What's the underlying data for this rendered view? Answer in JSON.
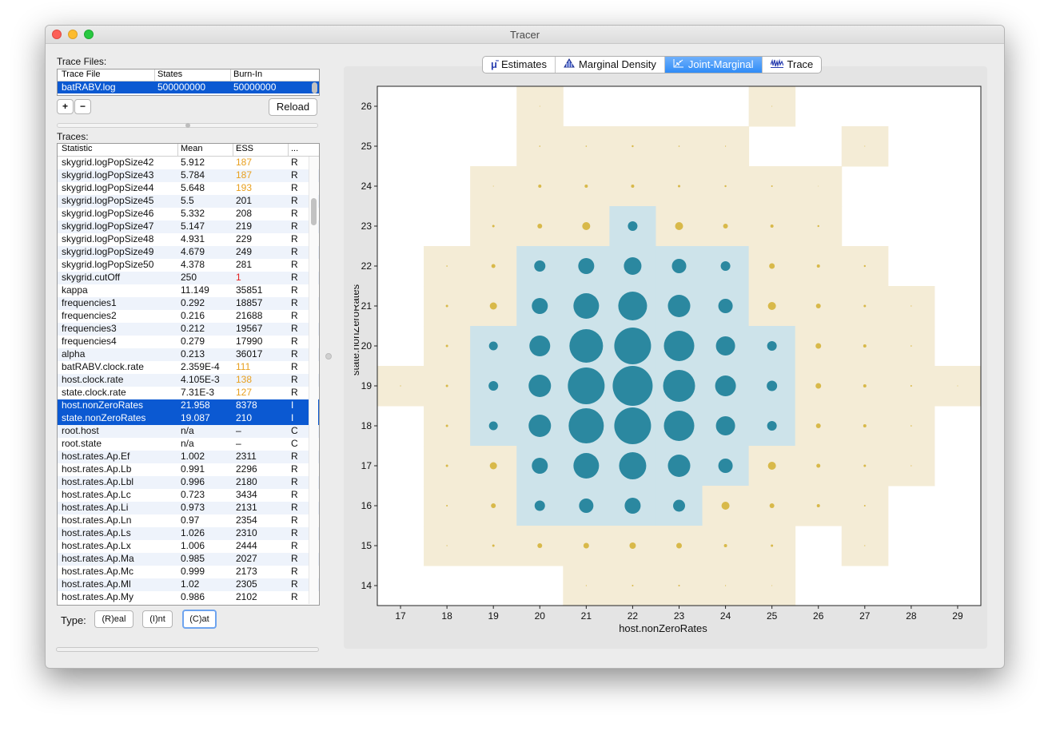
{
  "window": {
    "title": "Tracer"
  },
  "trace_files": {
    "label": "Trace Files:",
    "columns": [
      "Trace File",
      "States",
      "Burn-In"
    ],
    "row": {
      "file": "batRABV.log",
      "states": "500000000",
      "burnin": "50000000"
    },
    "add_label": "+",
    "remove_label": "−",
    "reload_label": "Reload"
  },
  "traces": {
    "label": "Traces:",
    "columns": [
      "Statistic",
      "Mean",
      "ESS",
      "..."
    ],
    "rows": [
      {
        "stat": "skygrid.logPopSize42",
        "mean": "5.912",
        "ess": "187",
        "type": "R",
        "ess_color": "#e8a020"
      },
      {
        "stat": "skygrid.logPopSize43",
        "mean": "5.784",
        "ess": "187",
        "type": "R",
        "ess_color": "#e8a020"
      },
      {
        "stat": "skygrid.logPopSize44",
        "mean": "5.648",
        "ess": "193",
        "type": "R",
        "ess_color": "#e8a020"
      },
      {
        "stat": "skygrid.logPopSize45",
        "mean": "5.5",
        "ess": "201",
        "type": "R"
      },
      {
        "stat": "skygrid.logPopSize46",
        "mean": "5.332",
        "ess": "208",
        "type": "R"
      },
      {
        "stat": "skygrid.logPopSize47",
        "mean": "5.147",
        "ess": "219",
        "type": "R"
      },
      {
        "stat": "skygrid.logPopSize48",
        "mean": "4.931",
        "ess": "229",
        "type": "R"
      },
      {
        "stat": "skygrid.logPopSize49",
        "mean": "4.679",
        "ess": "249",
        "type": "R"
      },
      {
        "stat": "skygrid.logPopSize50",
        "mean": "4.378",
        "ess": "281",
        "type": "R"
      },
      {
        "stat": "skygrid.cutOff",
        "mean": "250",
        "ess": "1",
        "type": "R",
        "ess_color": "#e32020"
      },
      {
        "stat": "kappa",
        "mean": "11.149",
        "ess": "35851",
        "type": "R"
      },
      {
        "stat": "frequencies1",
        "mean": "0.292",
        "ess": "18857",
        "type": "R"
      },
      {
        "stat": "frequencies2",
        "mean": "0.216",
        "ess": "21688",
        "type": "R"
      },
      {
        "stat": "frequencies3",
        "mean": "0.212",
        "ess": "19567",
        "type": "R"
      },
      {
        "stat": "frequencies4",
        "mean": "0.279",
        "ess": "17990",
        "type": "R"
      },
      {
        "stat": "alpha",
        "mean": "0.213",
        "ess": "36017",
        "type": "R"
      },
      {
        "stat": "batRABV.clock.rate",
        "mean": "2.359E-4",
        "ess": "111",
        "type": "R",
        "ess_color": "#e8a020"
      },
      {
        "stat": "host.clock.rate",
        "mean": "4.105E-3",
        "ess": "138",
        "type": "R",
        "ess_color": "#e8a020"
      },
      {
        "stat": "state.clock.rate",
        "mean": "7.31E-3",
        "ess": "127",
        "type": "R",
        "ess_color": "#e8a020"
      },
      {
        "stat": "host.nonZeroRates",
        "mean": "21.958",
        "ess": "8378",
        "type": "I",
        "selected": true
      },
      {
        "stat": "state.nonZeroRates",
        "mean": "19.087",
        "ess": "210",
        "type": "I",
        "selected": true
      },
      {
        "stat": "root.host",
        "mean": "n/a",
        "ess": "–",
        "type": "C"
      },
      {
        "stat": "root.state",
        "mean": "n/a",
        "ess": "–",
        "type": "C"
      },
      {
        "stat": "host.rates.Ap.Ef",
        "mean": "1.002",
        "ess": "2311",
        "type": "R"
      },
      {
        "stat": "host.rates.Ap.Lb",
        "mean": "0.991",
        "ess": "2296",
        "type": "R"
      },
      {
        "stat": "host.rates.Ap.Lbl",
        "mean": "0.996",
        "ess": "2180",
        "type": "R"
      },
      {
        "stat": "host.rates.Ap.Lc",
        "mean": "0.723",
        "ess": "3434",
        "type": "R"
      },
      {
        "stat": "host.rates.Ap.Li",
        "mean": "0.973",
        "ess": "2131",
        "type": "R"
      },
      {
        "stat": "host.rates.Ap.Ln",
        "mean": "0.97",
        "ess": "2354",
        "type": "R"
      },
      {
        "stat": "host.rates.Ap.Ls",
        "mean": "1.026",
        "ess": "2310",
        "type": "R"
      },
      {
        "stat": "host.rates.Ap.Lx",
        "mean": "1.006",
        "ess": "2444",
        "type": "R"
      },
      {
        "stat": "host.rates.Ap.Ma",
        "mean": "0.985",
        "ess": "2027",
        "type": "R"
      },
      {
        "stat": "host.rates.Ap.Mc",
        "mean": "0.999",
        "ess": "2173",
        "type": "R"
      },
      {
        "stat": "host.rates.Ap.Ml",
        "mean": "1.02",
        "ess": "2305",
        "type": "R"
      },
      {
        "stat": "host.rates.Ap.My",
        "mean": "0.986",
        "ess": "2102",
        "type": "R"
      }
    ]
  },
  "type_selector": {
    "label": "Type:",
    "options": [
      "(R)eal",
      "(I)nt",
      "(C)at"
    ],
    "selected": "(C)at"
  },
  "tabs": [
    {
      "label": "Estimates",
      "icon": "mu-icon"
    },
    {
      "label": "Marginal Density",
      "icon": "density-icon"
    },
    {
      "label": "Joint-Marginal",
      "icon": "joint-icon",
      "active": true
    },
    {
      "label": "Trace",
      "icon": "trace-icon"
    }
  ],
  "chart_data": {
    "type": "scatter",
    "xlabel": "host.nonZeroRates",
    "ylabel": "state.nonZeroRates",
    "xlim": [
      16.5,
      29.5
    ],
    "ylim": [
      13.5,
      26.5
    ],
    "xticks": [
      17,
      18,
      19,
      20,
      21,
      22,
      23,
      24,
      25,
      26,
      27,
      28,
      29
    ],
    "yticks": [
      14,
      15,
      16,
      17,
      18,
      19,
      20,
      21,
      22,
      23,
      24,
      25,
      26
    ],
    "colors": {
      "hpd_cell": "#cde3ea",
      "outer_cell": "#f4ecd6",
      "hpd_point": "#2b88a0",
      "outer_point": "#d8b94a"
    },
    "points": [
      {
        "x": 20,
        "y": 26,
        "r": 0.5,
        "hpd": false
      },
      {
        "x": 25,
        "y": 26,
        "r": 0.5,
        "hpd": false
      },
      {
        "x": 20,
        "y": 25,
        "r": 0.8,
        "hpd": false
      },
      {
        "x": 21,
        "y": 25,
        "r": 0.8,
        "hpd": false
      },
      {
        "x": 22,
        "y": 25,
        "r": 1.2,
        "hpd": false
      },
      {
        "x": 23,
        "y": 25,
        "r": 0.8,
        "hpd": false
      },
      {
        "x": 24,
        "y": 25,
        "r": 0.6,
        "hpd": false
      },
      {
        "x": 27,
        "y": 25,
        "r": 0.5,
        "hpd": false
      },
      {
        "x": 19,
        "y": 24,
        "r": 0.5,
        "hpd": false
      },
      {
        "x": 20,
        "y": 24,
        "r": 2,
        "hpd": false
      },
      {
        "x": 21,
        "y": 24,
        "r": 2,
        "hpd": false
      },
      {
        "x": 22,
        "y": 24,
        "r": 2,
        "hpd": false
      },
      {
        "x": 23,
        "y": 24,
        "r": 1.5,
        "hpd": false
      },
      {
        "x": 24,
        "y": 24,
        "r": 1.2,
        "hpd": false
      },
      {
        "x": 25,
        "y": 24,
        "r": 1,
        "hpd": false
      },
      {
        "x": 26,
        "y": 24,
        "r": 0.4,
        "hpd": false
      },
      {
        "x": 19,
        "y": 23,
        "r": 1.5,
        "hpd": false
      },
      {
        "x": 20,
        "y": 23,
        "r": 3,
        "hpd": false
      },
      {
        "x": 21,
        "y": 23,
        "r": 5,
        "hpd": false
      },
      {
        "x": 22,
        "y": 23,
        "r": 6,
        "hpd": true
      },
      {
        "x": 23,
        "y": 23,
        "r": 5,
        "hpd": false
      },
      {
        "x": 24,
        "y": 23,
        "r": 3,
        "hpd": false
      },
      {
        "x": 25,
        "y": 23,
        "r": 2,
        "hpd": false
      },
      {
        "x": 26,
        "y": 23,
        "r": 1.2,
        "hpd": false
      },
      {
        "x": 18,
        "y": 22,
        "r": 0.8,
        "hpd": false
      },
      {
        "x": 19,
        "y": 22,
        "r": 2.5,
        "hpd": false
      },
      {
        "x": 20,
        "y": 22,
        "r": 7,
        "hpd": true
      },
      {
        "x": 21,
        "y": 22,
        "r": 10,
        "hpd": true
      },
      {
        "x": 22,
        "y": 22,
        "r": 11,
        "hpd": true
      },
      {
        "x": 23,
        "y": 22,
        "r": 9,
        "hpd": true
      },
      {
        "x": 24,
        "y": 22,
        "r": 6,
        "hpd": true
      },
      {
        "x": 25,
        "y": 22,
        "r": 3.5,
        "hpd": false
      },
      {
        "x": 26,
        "y": 22,
        "r": 2,
        "hpd": false
      },
      {
        "x": 27,
        "y": 22,
        "r": 1.2,
        "hpd": false
      },
      {
        "x": 18,
        "y": 21,
        "r": 1.5,
        "hpd": false
      },
      {
        "x": 19,
        "y": 21,
        "r": 4.5,
        "hpd": false
      },
      {
        "x": 20,
        "y": 21,
        "r": 10,
        "hpd": true
      },
      {
        "x": 21,
        "y": 21,
        "r": 16,
        "hpd": true
      },
      {
        "x": 22,
        "y": 21,
        "r": 18,
        "hpd": true
      },
      {
        "x": 23,
        "y": 21,
        "r": 14,
        "hpd": true
      },
      {
        "x": 24,
        "y": 21,
        "r": 9,
        "hpd": true
      },
      {
        "x": 25,
        "y": 21,
        "r": 5,
        "hpd": false
      },
      {
        "x": 26,
        "y": 21,
        "r": 3,
        "hpd": false
      },
      {
        "x": 27,
        "y": 21,
        "r": 1.5,
        "hpd": false
      },
      {
        "x": 28,
        "y": 21,
        "r": 0.6,
        "hpd": false
      },
      {
        "x": 18,
        "y": 20,
        "r": 1.5,
        "hpd": false
      },
      {
        "x": 19,
        "y": 20,
        "r": 5.5,
        "hpd": true
      },
      {
        "x": 20,
        "y": 20,
        "r": 13,
        "hpd": true
      },
      {
        "x": 21,
        "y": 20,
        "r": 21,
        "hpd": true
      },
      {
        "x": 22,
        "y": 20,
        "r": 23,
        "hpd": true
      },
      {
        "x": 23,
        "y": 20,
        "r": 19,
        "hpd": true
      },
      {
        "x": 24,
        "y": 20,
        "r": 12,
        "hpd": true
      },
      {
        "x": 25,
        "y": 20,
        "r": 6,
        "hpd": true
      },
      {
        "x": 26,
        "y": 20,
        "r": 3.5,
        "hpd": false
      },
      {
        "x": 27,
        "y": 20,
        "r": 2,
        "hpd": false
      },
      {
        "x": 28,
        "y": 20,
        "r": 0.8,
        "hpd": false
      },
      {
        "x": 17,
        "y": 19,
        "r": 0.6,
        "hpd": false
      },
      {
        "x": 18,
        "y": 19,
        "r": 1.5,
        "hpd": false
      },
      {
        "x": 19,
        "y": 19,
        "r": 6,
        "hpd": true
      },
      {
        "x": 20,
        "y": 19,
        "r": 14,
        "hpd": true
      },
      {
        "x": 21,
        "y": 19,
        "r": 23,
        "hpd": true
      },
      {
        "x": 22,
        "y": 19,
        "r": 25,
        "hpd": true
      },
      {
        "x": 23,
        "y": 19,
        "r": 20,
        "hpd": true
      },
      {
        "x": 24,
        "y": 19,
        "r": 13,
        "hpd": true
      },
      {
        "x": 25,
        "y": 19,
        "r": 6.5,
        "hpd": true
      },
      {
        "x": 26,
        "y": 19,
        "r": 3.5,
        "hpd": false
      },
      {
        "x": 27,
        "y": 19,
        "r": 2,
        "hpd": false
      },
      {
        "x": 28,
        "y": 19,
        "r": 1,
        "hpd": false
      },
      {
        "x": 29,
        "y": 19,
        "r": 0.5,
        "hpd": false
      },
      {
        "x": 18,
        "y": 18,
        "r": 1.5,
        "hpd": false
      },
      {
        "x": 19,
        "y": 18,
        "r": 5.5,
        "hpd": true
      },
      {
        "x": 20,
        "y": 18,
        "r": 14,
        "hpd": true
      },
      {
        "x": 21,
        "y": 18,
        "r": 22,
        "hpd": true
      },
      {
        "x": 22,
        "y": 18,
        "r": 23,
        "hpd": true
      },
      {
        "x": 23,
        "y": 18,
        "r": 19,
        "hpd": true
      },
      {
        "x": 24,
        "y": 18,
        "r": 12,
        "hpd": true
      },
      {
        "x": 25,
        "y": 18,
        "r": 6,
        "hpd": true
      },
      {
        "x": 26,
        "y": 18,
        "r": 3,
        "hpd": false
      },
      {
        "x": 27,
        "y": 18,
        "r": 2,
        "hpd": false
      },
      {
        "x": 28,
        "y": 18,
        "r": 0.8,
        "hpd": false
      },
      {
        "x": 18,
        "y": 17,
        "r": 1.5,
        "hpd": false
      },
      {
        "x": 19,
        "y": 17,
        "r": 4.5,
        "hpd": false
      },
      {
        "x": 20,
        "y": 17,
        "r": 10,
        "hpd": true
      },
      {
        "x": 21,
        "y": 17,
        "r": 16,
        "hpd": true
      },
      {
        "x": 22,
        "y": 17,
        "r": 17,
        "hpd": true
      },
      {
        "x": 23,
        "y": 17,
        "r": 14,
        "hpd": true
      },
      {
        "x": 24,
        "y": 17,
        "r": 9,
        "hpd": true
      },
      {
        "x": 25,
        "y": 17,
        "r": 5,
        "hpd": false
      },
      {
        "x": 26,
        "y": 17,
        "r": 2.5,
        "hpd": false
      },
      {
        "x": 27,
        "y": 17,
        "r": 1.5,
        "hpd": false
      },
      {
        "x": 28,
        "y": 17,
        "r": 0.6,
        "hpd": false
      },
      {
        "x": 18,
        "y": 16,
        "r": 1,
        "hpd": false
      },
      {
        "x": 19,
        "y": 16,
        "r": 3,
        "hpd": false
      },
      {
        "x": 20,
        "y": 16,
        "r": 6.5,
        "hpd": true
      },
      {
        "x": 21,
        "y": 16,
        "r": 9,
        "hpd": true
      },
      {
        "x": 22,
        "y": 16,
        "r": 10,
        "hpd": true
      },
      {
        "x": 23,
        "y": 16,
        "r": 7.5,
        "hpd": true
      },
      {
        "x": 24,
        "y": 16,
        "r": 5,
        "hpd": false
      },
      {
        "x": 25,
        "y": 16,
        "r": 3,
        "hpd": false
      },
      {
        "x": 26,
        "y": 16,
        "r": 2,
        "hpd": false
      },
      {
        "x": 27,
        "y": 16,
        "r": 1,
        "hpd": false
      },
      {
        "x": 18,
        "y": 15,
        "r": 0.6,
        "hpd": false
      },
      {
        "x": 19,
        "y": 15,
        "r": 1.5,
        "hpd": false
      },
      {
        "x": 20,
        "y": 15,
        "r": 3,
        "hpd": false
      },
      {
        "x": 21,
        "y": 15,
        "r": 3.5,
        "hpd": false
      },
      {
        "x": 22,
        "y": 15,
        "r": 4,
        "hpd": false
      },
      {
        "x": 23,
        "y": 15,
        "r": 3.5,
        "hpd": false
      },
      {
        "x": 24,
        "y": 15,
        "r": 2,
        "hpd": false
      },
      {
        "x": 25,
        "y": 15,
        "r": 1.5,
        "hpd": false
      },
      {
        "x": 27,
        "y": 15,
        "r": 0.6,
        "hpd": false
      },
      {
        "x": 21,
        "y": 14,
        "r": 0.6,
        "hpd": false
      },
      {
        "x": 22,
        "y": 14,
        "r": 1,
        "hpd": false
      },
      {
        "x": 23,
        "y": 14,
        "r": 1,
        "hpd": false
      },
      {
        "x": 24,
        "y": 14,
        "r": 0.6,
        "hpd": false
      },
      {
        "x": 25,
        "y": 14,
        "r": 0.5,
        "hpd": false
      }
    ]
  }
}
